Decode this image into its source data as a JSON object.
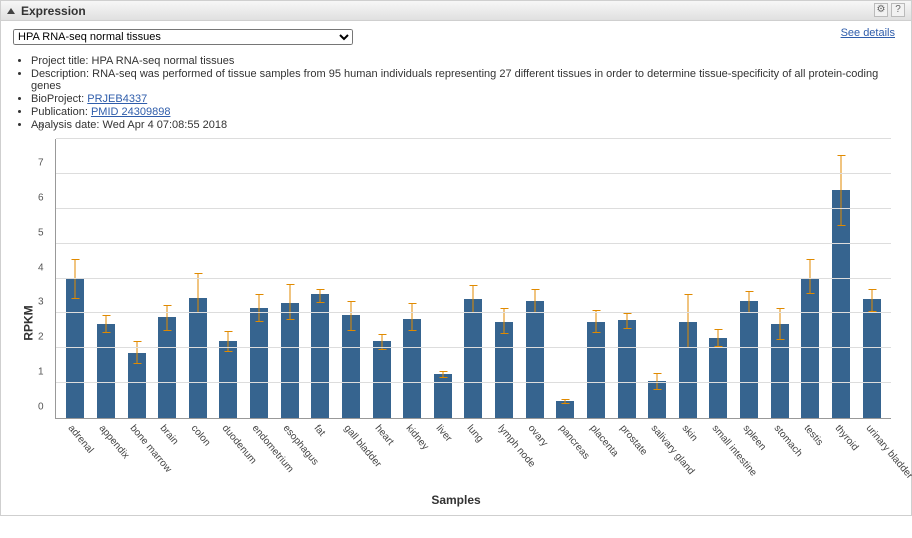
{
  "panel": {
    "title": "Expression",
    "see_details": "See details"
  },
  "dataset_select": {
    "selected": "HPA RNA-seq normal tissues"
  },
  "meta": {
    "project_title_label": "Project title:",
    "project_title": "HPA RNA-seq normal tissues",
    "description_label": "Description:",
    "description": "RNA-seq was performed of tissue samples from 95 human individuals representing 27 different tissues in order to determine tissue-specificity of all protein-coding genes",
    "bioproject_label": "BioProject:",
    "bioproject_link": "PRJEB4337",
    "publication_label": "Publication:",
    "publication_link": "PMID 24309898",
    "analysis_date_label": "Analysis date:",
    "analysis_date": "Wed Apr 4 07:08:55 2018"
  },
  "chart_data": {
    "type": "bar",
    "ylabel": "RPKM",
    "xlabel": "Samples",
    "ylim": [
      0,
      8
    ],
    "yticks": [
      0,
      1,
      2,
      3,
      4,
      5,
      6,
      7,
      8
    ],
    "categories": [
      "adrenal",
      "appendix",
      "bone marrow",
      "brain",
      "colon",
      "duodenum",
      "endometrium",
      "esophagus",
      "fat",
      "gall bladder",
      "heart",
      "kidney",
      "liver",
      "lung",
      "lymph node",
      "ovary",
      "pancreas",
      "placenta",
      "prostate",
      "salivary gland",
      "skin",
      "small intestine",
      "spleen",
      "stomach",
      "testis",
      "thyroid",
      "urinary bladder"
    ],
    "values": [
      4.0,
      2.7,
      1.85,
      2.9,
      3.45,
      2.2,
      3.15,
      3.3,
      3.55,
      2.95,
      2.2,
      2.85,
      1.25,
      3.4,
      2.75,
      3.35,
      0.5,
      2.75,
      2.8,
      1.05,
      2.75,
      2.3,
      3.35,
      2.7,
      4.0,
      6.55,
      3.4
    ],
    "err_low": [
      3.4,
      2.45,
      1.55,
      2.5,
      3.0,
      1.9,
      2.75,
      2.8,
      3.3,
      2.5,
      1.95,
      2.5,
      1.15,
      3.0,
      2.4,
      3.0,
      0.4,
      2.45,
      2.55,
      0.8,
      2.0,
      2.05,
      3.0,
      2.25,
      3.55,
      5.5,
      3.05
    ],
    "err_high": [
      4.55,
      2.95,
      2.2,
      3.25,
      4.15,
      2.5,
      3.55,
      3.85,
      3.7,
      3.35,
      2.4,
      3.3,
      1.35,
      3.8,
      3.15,
      3.7,
      0.55,
      3.1,
      3.0,
      1.3,
      3.55,
      2.55,
      3.65,
      3.15,
      4.55,
      7.55,
      3.7
    ]
  }
}
